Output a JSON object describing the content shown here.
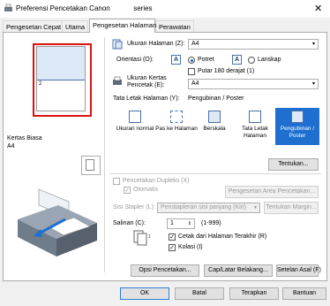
{
  "window": {
    "title": "Preferensi Pencetakan Canon",
    "title_suffix": "series",
    "close_glyph": "✕"
  },
  "tabs": [
    {
      "label": "Pengesetan Cepat"
    },
    {
      "label": "Utama"
    },
    {
      "label": "Pengesetan Halaman"
    },
    {
      "label": "Perawatan"
    }
  ],
  "preview": {
    "page_number": "2",
    "media_type": "Kertas Biasa",
    "media_size": "A4"
  },
  "page_size": {
    "label": "Ukuran Halaman (Z):",
    "value": "A4"
  },
  "orientation": {
    "label": "Orientasi (O):",
    "portrait": "Potret",
    "landscape": "Lanskap",
    "rotate180": "Putar 180 derajat (1)",
    "portrait_glyph": "A",
    "landscape_glyph": "A"
  },
  "printer_paper": {
    "label_line1": "Ukuran Kertas",
    "label_line2": "Pencetak (E):",
    "value": "A4"
  },
  "layout": {
    "label": "Tata Letak Halaman (Y):",
    "current": "Pengubinan / Poster",
    "items": [
      {
        "label": "Ukuran normal"
      },
      {
        "label": "Pas ke Halaman"
      },
      {
        "label": "Berskala"
      },
      {
        "label": "Tata Letak Halaman"
      },
      {
        "label": "Pengubinan / Poster"
      }
    ],
    "specify_button": "Tentukan..."
  },
  "duplex": {
    "label": "Pencetakan Dupleks (X)",
    "auto_label": "Otomatis",
    "print_area_button": "Pengesetan Area Pencetakan..."
  },
  "stapling": {
    "label": "Sisi Stapler (L):",
    "value": "Penstapleran sisi panjang (Kiri)",
    "margin_button": "Tentukan Margin..."
  },
  "copies": {
    "label": "Salinan (C):",
    "value": "1",
    "range": "(1-999)",
    "last_page_first": "Cetak dari Halaman Terakhir (R)",
    "collate": "Kolasi (I)"
  },
  "bottom_buttons": {
    "print_options": "Opsi Pencetakan...",
    "stamp_bg": "Cap/Latar Belakang...",
    "defaults": "Setelan Asal (F)"
  },
  "dialog_buttons": {
    "ok": "OK",
    "cancel": "Batal",
    "apply": "Terapkan",
    "help": "Bantuan"
  }
}
